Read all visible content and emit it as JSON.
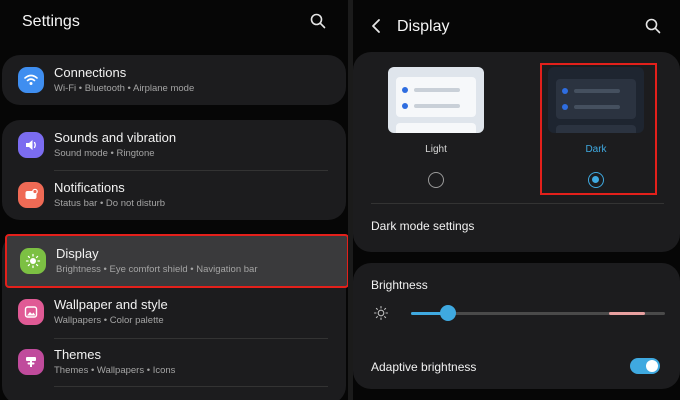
{
  "left": {
    "title": "Settings",
    "items": [
      {
        "title": "Connections",
        "subtitle": "Wi-Fi  •  Bluetooth  •  Airplane mode",
        "icon": "wifi-icon",
        "color": "#3f8ef0"
      },
      {
        "title": "Sounds and vibration",
        "subtitle": "Sound mode  •  Ringtone",
        "icon": "speaker-icon",
        "color": "#7b6cf0"
      },
      {
        "title": "Notifications",
        "subtitle": "Status bar  •  Do not disturb",
        "icon": "bell-icon",
        "color": "#ef6a55"
      },
      {
        "title": "Display",
        "subtitle": "Brightness  •  Eye comfort shield  •  Navigation bar",
        "icon": "sun-icon",
        "color": "#7cc043"
      },
      {
        "title": "Wallpaper and style",
        "subtitle": "Wallpapers  •  Color palette",
        "icon": "image-icon",
        "color": "#e05a95"
      },
      {
        "title": "Themes",
        "subtitle": "Themes  •  Wallpapers  •  Icons",
        "icon": "themes-icon",
        "color": "#c04b9c"
      }
    ]
  },
  "right": {
    "title": "Display",
    "light_label": "Light",
    "dark_label": "Dark",
    "selected_theme": "dark",
    "dark_mode_settings": "Dark mode settings",
    "brightness_label": "Brightness",
    "brightness_level": 0.16,
    "adaptive_label": "Adaptive brightness",
    "adaptive_on": true
  },
  "colors": {
    "accent": "#3fa9e0",
    "highlight": "#e3201b"
  }
}
